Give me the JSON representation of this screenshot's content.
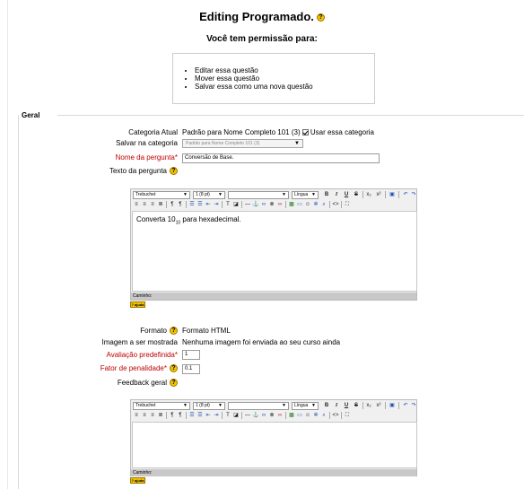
{
  "page": {
    "title": "Editing Programado.",
    "subtitle": "Você tem permissão para:",
    "permissions": [
      "Editar essa questão",
      "Mover essa questão",
      "Salvar essa como uma nova questão"
    ],
    "fieldset_legend": "Geral"
  },
  "form": {
    "category_current_label": "Categoria Atual",
    "category_current_value": "Padrão para Nome Completo 101 (3)",
    "use_category_label": "Usar essa categoria",
    "save_in_category_label": "Salvar na categoria",
    "save_in_category_value": "Padrão para Nome Completo 101 (3)",
    "question_name_label": "Nome da pergunta*",
    "question_name_value": "Conversão de Base.",
    "question_text_label": "Texto da pergunta",
    "format_label": "Formato",
    "format_value": "Formato HTML",
    "image_label": "Imagem a ser mostrada",
    "image_value": "Nenhuma imagem foi enviada ao seu curso ainda",
    "default_grade_label": "Avaliação predefinida*",
    "default_grade_value": "1",
    "penalty_label": "Fator de penalidade*",
    "penalty_value": "0.1",
    "general_feedback_label": "Feedback geral"
  },
  "editor1": {
    "font": "Trebuchet",
    "size": "1 (8 pt)",
    "style": "",
    "language": "Língua",
    "content_before": "Converta 10",
    "content_sub": "10",
    "content_after": " para hexadecimal.",
    "path_label": "Caminho:",
    "help_label": "? ajuda"
  },
  "editor2": {
    "font": "Trebuchet",
    "size": "1 (8 pt)",
    "style": "",
    "language": "Língua",
    "path_label": "Caminho:",
    "help_label": "? ajuda"
  },
  "icons": {
    "help": "help-icon",
    "toolbar": [
      "bold-icon",
      "italic-icon",
      "underline-icon",
      "strikethrough-icon",
      "subscript-icon",
      "superscript-icon",
      "clean-icon",
      "undo-icon",
      "redo-icon"
    ]
  },
  "colors": {
    "required_label": "#c00000",
    "help_yellow": "#f2c200"
  }
}
